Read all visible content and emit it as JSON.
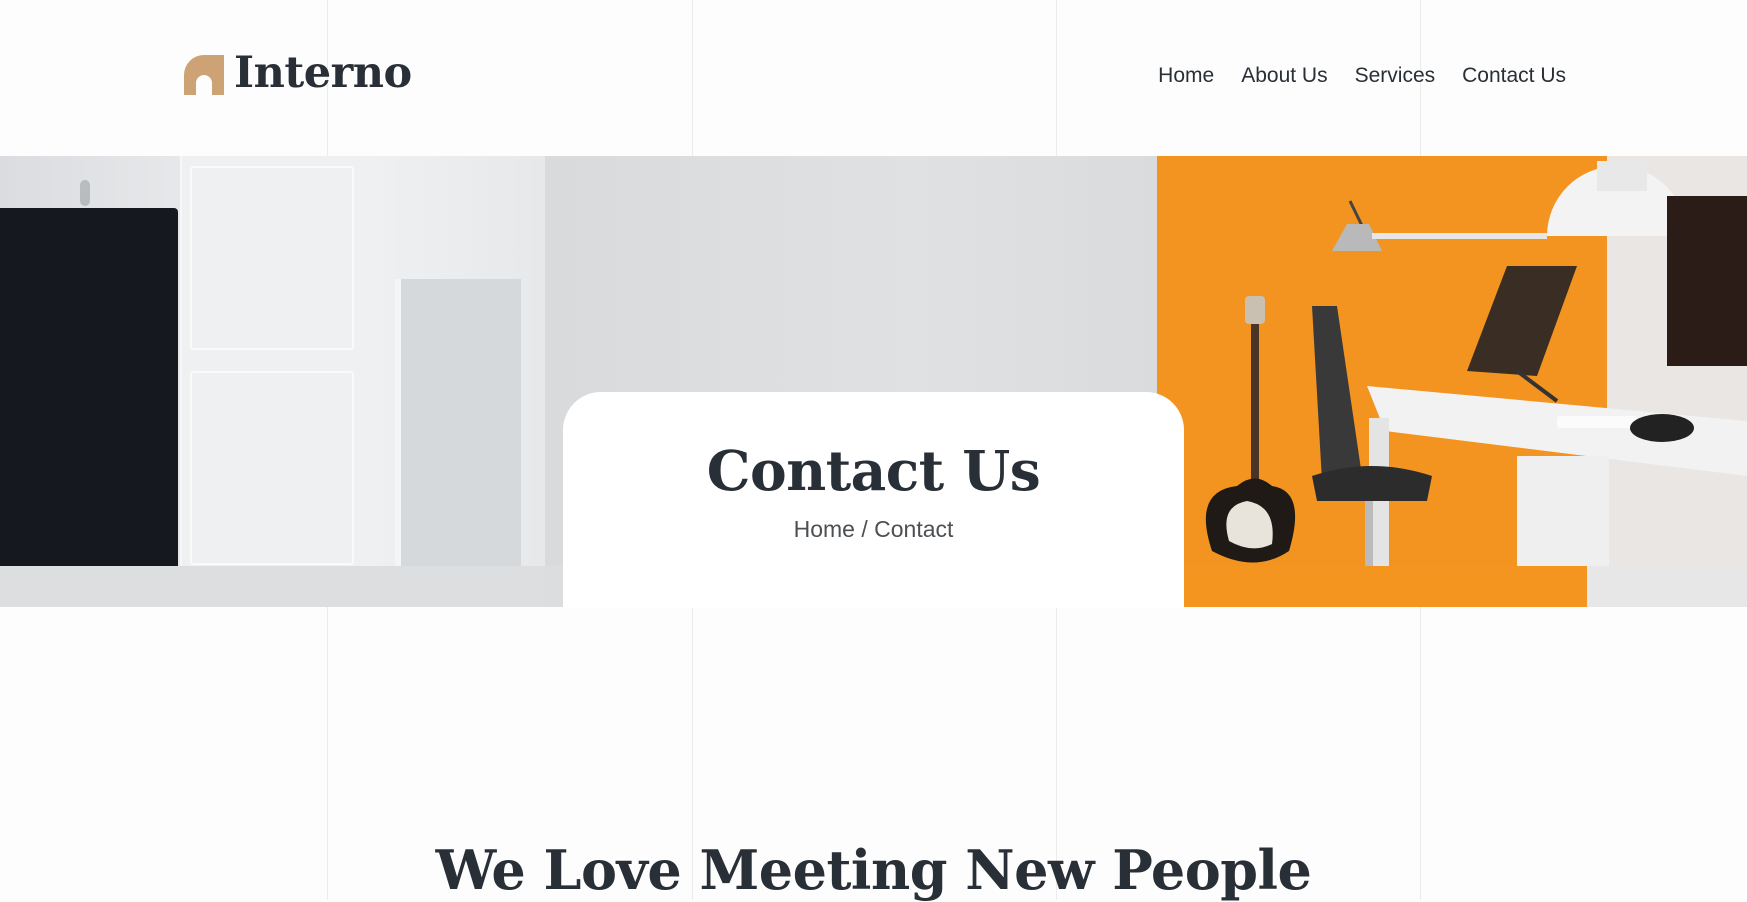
{
  "brand": {
    "name": "Interno",
    "accent": "#cda274"
  },
  "nav": {
    "items": [
      {
        "label": "Home"
      },
      {
        "label": "About Us"
      },
      {
        "label": "Services"
      },
      {
        "label": "Contact Us"
      }
    ]
  },
  "hero": {
    "title": "Contact Us",
    "breadcrumb": {
      "home": "Home",
      "separator": " / ",
      "current": "Contact"
    }
  },
  "section": {
    "heading": "We Love Meeting New People"
  },
  "colors": {
    "text": "#292f36",
    "accent": "#cda274",
    "hero_orange": "#f39420",
    "background": "#fdfdfd"
  }
}
